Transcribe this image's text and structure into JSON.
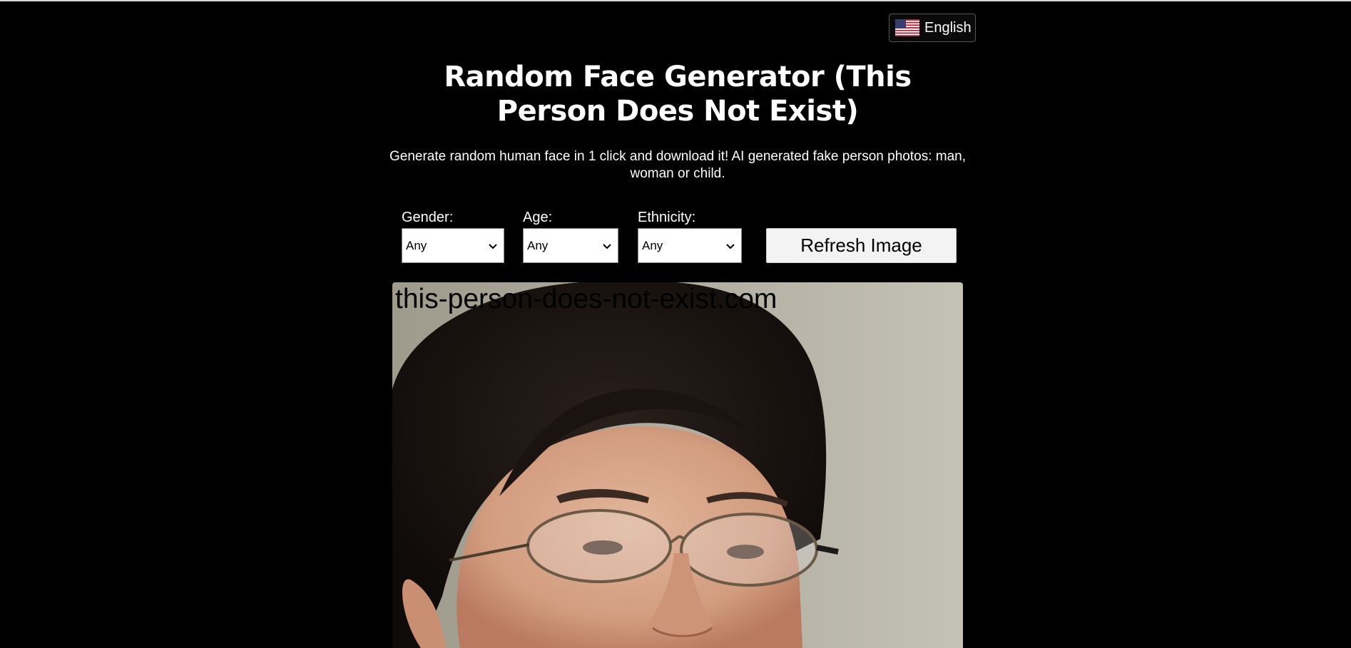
{
  "language": {
    "label": "English",
    "flag_icon": "us-flag-icon"
  },
  "title": "Random Face Generator (This Person Does Not Exist)",
  "subtitle": "Generate random human face in 1 click and download it! AI generated fake person photos: man, woman or child.",
  "filters": {
    "gender": {
      "label": "Gender:",
      "value": "Any"
    },
    "age": {
      "label": "Age:",
      "value": "Any"
    },
    "ethnicity": {
      "label": "Ethnicity:",
      "value": "Any"
    }
  },
  "refresh_label": "Refresh Image",
  "image": {
    "watermark": "this-person-does-not-exist.com",
    "subject": "generated-face-photo"
  },
  "colors": {
    "background": "#000000",
    "text": "#ffffff",
    "button_bg": "#f3f3f3"
  }
}
